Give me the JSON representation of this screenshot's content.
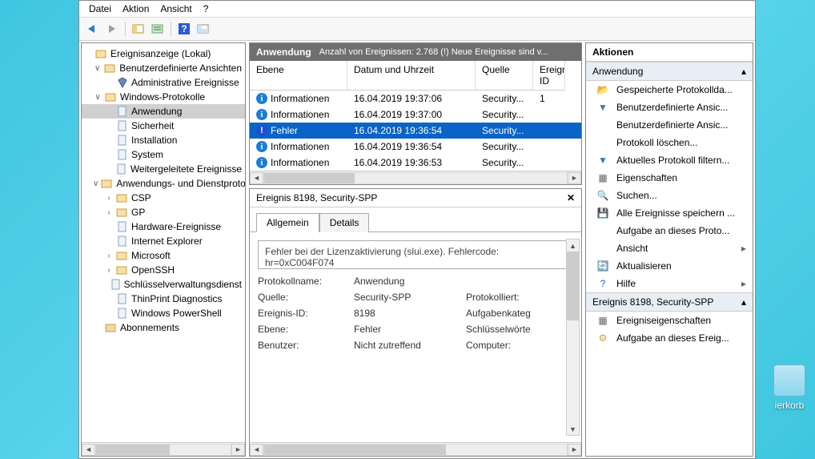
{
  "menu": {
    "file": "Datei",
    "action": "Aktion",
    "view": "Ansicht",
    "help": "?"
  },
  "tree": {
    "root": "Ereignisanzeige (Lokal)",
    "custom": "Benutzerdefinierte Ansichten",
    "admin": "Administrative Ereignisse",
    "winlog": "Windows-Protokolle",
    "app": "Anwendung",
    "sec": "Sicherheit",
    "setup": "Installation",
    "sys": "System",
    "fwd": "Weitergeleitete Ereignisse",
    "svc": "Anwendungs- und Dienstprotokolle",
    "csp": "CSP",
    "gp": "GP",
    "hw": "Hardware-Ereignisse",
    "ie": "Internet Explorer",
    "ms": "Microsoft",
    "ssh": "OpenSSH",
    "key": "Schlüsselverwaltungsdienst",
    "tp": "ThinPrint Diagnostics",
    "ps": "Windows PowerShell",
    "subs": "Abonnements"
  },
  "grid": {
    "title": "Anwendung",
    "subtitle": "Anzahl von Ereignissen: 2.768 (!) Neue Ereignisse sind v...",
    "cols": {
      "lvl": "Ebene",
      "date": "Datum und Uhrzeit",
      "src": "Quelle",
      "id": "Ereignis-ID"
    },
    "rows": [
      {
        "icon": "info",
        "lvl": "Informationen",
        "date": "16.04.2019 19:37:06",
        "src": "Security...",
        "id": "1"
      },
      {
        "icon": "info",
        "lvl": "Informationen",
        "date": "16.04.2019 19:37:00",
        "src": "Security...",
        "id": ""
      },
      {
        "icon": "err",
        "lvl": "Fehler",
        "date": "16.04.2019 19:36:54",
        "src": "Security...",
        "id": ""
      },
      {
        "icon": "info",
        "lvl": "Informationen",
        "date": "16.04.2019 19:36:54",
        "src": "Security...",
        "id": ""
      },
      {
        "icon": "info",
        "lvl": "Informationen",
        "date": "16.04.2019 19:36:53",
        "src": "Security...",
        "id": ""
      }
    ],
    "selected": 2
  },
  "detail": {
    "title": "Ereignis 8198, Security-SPP",
    "tabs": {
      "general": "Allgemein",
      "details": "Details"
    },
    "message": "Fehler bei der Lizenzaktivierung (slui.exe). Fehlercode:\nhr=0xC004F074",
    "props": {
      "logname_k": "Protokollname:",
      "logname_v": "Anwendung",
      "source_k": "Quelle:",
      "source_v": "Security-SPP",
      "source_r": "Protokolliert:",
      "id_k": "Ereignis-ID:",
      "id_v": "8198",
      "id_r": "Aufgabenkategorie:",
      "level_k": "Ebene:",
      "level_v": "Fehler",
      "level_r": "Schlüsselwörter:",
      "user_k": "Benutzer:",
      "user_v": "Nicht zutreffend",
      "user_r": "Computer:"
    }
  },
  "actions": {
    "title": "Aktionen",
    "group1": "Anwendung",
    "items1": [
      "Gespeicherte Protokollda...",
      "Benutzerdefinierte Ansic...",
      "Benutzerdefinierte Ansic...",
      "Protokoll löschen...",
      "Aktuelles Protokoll filtern...",
      "Eigenschaften",
      "Suchen...",
      "Alle Ereignisse speichern ...",
      "Aufgabe an dieses Proto...",
      "Ansicht",
      "Aktualisieren",
      "Hilfe"
    ],
    "group2": "Ereignis 8198, Security-SPP",
    "items2": [
      "Ereigniseigenschaften",
      "Aufgabe an dieses Ereig..."
    ]
  },
  "desktop": {
    "recycle": "ierkorb"
  }
}
